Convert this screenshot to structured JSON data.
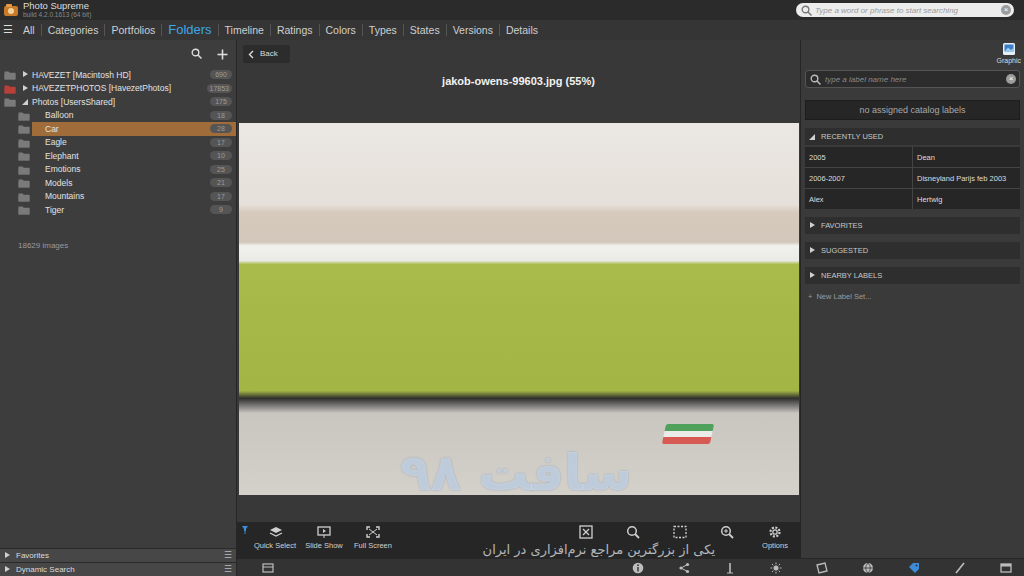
{
  "app": {
    "title": "Photo Supreme",
    "build": "build 4.2.0.1613 (64 bit)"
  },
  "search": {
    "placeholder": "Type a word or phrase to start searching",
    "clear": "×"
  },
  "menu_icon": "☰",
  "tabs": [
    {
      "label": "All",
      "selected": false
    },
    {
      "label": "Categories",
      "selected": false
    },
    {
      "label": "Portfolios",
      "selected": false
    },
    {
      "label": "Folders",
      "selected": true
    },
    {
      "label": "Timeline",
      "selected": false
    },
    {
      "label": "Ratings",
      "selected": false
    },
    {
      "label": "Colors",
      "selected": false
    },
    {
      "label": "Types",
      "selected": false
    },
    {
      "label": "States",
      "selected": false
    },
    {
      "label": "Versions",
      "selected": false
    },
    {
      "label": "Details",
      "selected": false
    }
  ],
  "tree": {
    "roots": [
      {
        "label": "HAVEZET [Macintosh HD]",
        "count": "690",
        "expanded": false,
        "selected": false,
        "color": "#7a7a7a",
        "children": []
      },
      {
        "label": "HAVEZETPHOTOS [HavezetPhotos]",
        "count": "17853",
        "expanded": false,
        "selected": false,
        "color": "#b8403a",
        "children": []
      },
      {
        "label": "Photos [UsersShared]",
        "count": "175",
        "expanded": true,
        "selected": false,
        "color": "#7a7a7a",
        "children": [
          {
            "label": "Balloon",
            "count": "18",
            "selected": false
          },
          {
            "label": "Car",
            "count": "28",
            "selected": true
          },
          {
            "label": "Eagle",
            "count": "17",
            "selected": false
          },
          {
            "label": "Elephant",
            "count": "10",
            "selected": false
          },
          {
            "label": "Emotions",
            "count": "25",
            "selected": false
          },
          {
            "label": "Models",
            "count": "21",
            "selected": false
          },
          {
            "label": "Mountains",
            "count": "17",
            "selected": false
          },
          {
            "label": "Tiger",
            "count": "9",
            "selected": false
          }
        ]
      }
    ],
    "footer": "18629 images"
  },
  "left_sections": [
    {
      "label": "Favorites",
      "expanded": false,
      "menu": "☰"
    },
    {
      "label": "Dynamic Search",
      "expanded": false,
      "menu": "☰"
    }
  ],
  "viewer": {
    "back": "Back",
    "title": "jakob-owens-99603.jpg (55%)"
  },
  "toolbar": [
    {
      "kind": "labeled",
      "label": "Quick Select"
    },
    {
      "kind": "labeled",
      "label": "Slide Show"
    },
    {
      "kind": "labeled",
      "label": "Full Screen"
    },
    {
      "kind": "icon",
      "label": ""
    },
    {
      "kind": "icon",
      "label": ""
    },
    {
      "kind": "icon",
      "label": ""
    },
    {
      "kind": "icon",
      "label": ""
    },
    {
      "kind": "labeled",
      "label": "Options"
    }
  ],
  "graphic": {
    "label": "Graphic"
  },
  "label_search": {
    "placeholder": "type a label name here",
    "clear": "×"
  },
  "assigned": "no assigned catalog labels",
  "sections": [
    {
      "title": "RECENTLY USED",
      "expanded": true,
      "items": [
        "2005",
        "Dean",
        "2006-2007",
        "Disneyland Parijs feb 2003",
        "Alex",
        "Hertwig"
      ]
    },
    {
      "title": "FAVORITES",
      "expanded": false,
      "items": []
    },
    {
      "title": "SUGGESTED",
      "expanded": false,
      "items": []
    },
    {
      "title": "NEARBY LABELS",
      "expanded": false,
      "items": []
    }
  ],
  "new_label_set": {
    "icon": "+",
    "label": "New Label Set..."
  },
  "bottom_tools": [
    {
      "selected": false
    },
    {
      "selected": false
    },
    {
      "selected": false
    },
    {
      "selected": false
    },
    {
      "selected": false
    },
    {
      "selected": false
    },
    {
      "selected": false
    },
    {
      "selected": true
    },
    {
      "selected": false
    },
    {
      "selected": false
    }
  ],
  "watermark": {
    "title": "سافت ۹۸",
    "subtitle": "یکی از بزرگترین مراجع نرم‌افزاری در ایران"
  }
}
